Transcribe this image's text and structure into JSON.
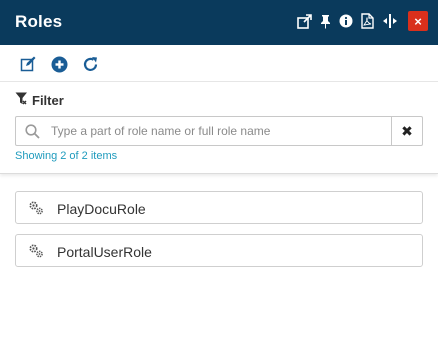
{
  "header": {
    "title": "Roles",
    "close_label": "×",
    "icons": [
      "pop-out-icon",
      "pin-icon",
      "info-icon",
      "pdf-icon",
      "resize-icon",
      "close-icon"
    ],
    "background": "#0a3a5c",
    "close_color": "#d9301c"
  },
  "toolbar": {
    "icons": [
      "edit-icon",
      "add-icon",
      "refresh-icon"
    ],
    "accent": "#1a5d96"
  },
  "filter": {
    "label": "Filter",
    "placeholder": "Type a part of role name or full role name",
    "value": "",
    "clear_label": "✖",
    "showing_text": "Showing 2 of 2 items",
    "showing_color": "#1f9bbd"
  },
  "roles": [
    {
      "label": "PlayDocuRole",
      "icon": "gears-icon"
    },
    {
      "label": "PortalUserRole",
      "icon": "gears-icon"
    }
  ]
}
